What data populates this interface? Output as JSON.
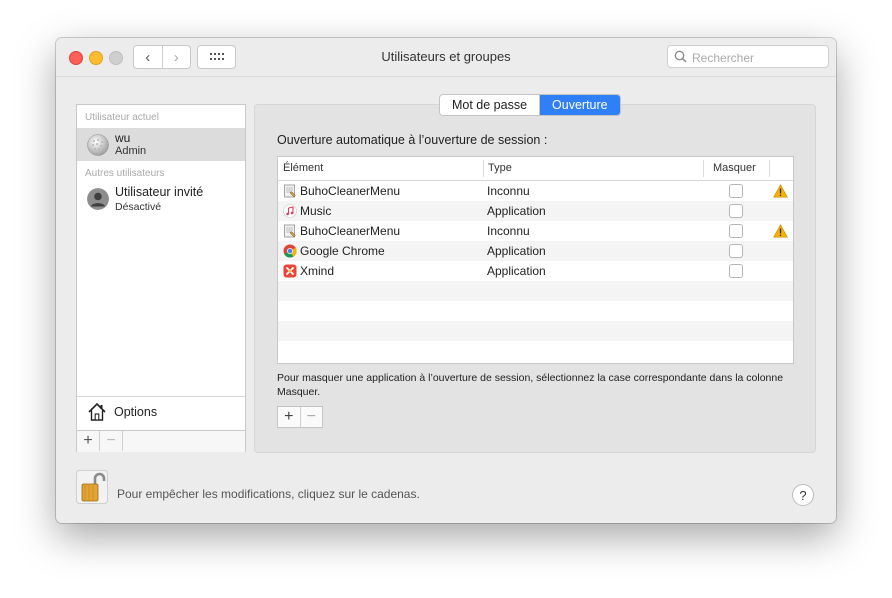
{
  "window": {
    "title": "Utilisateurs et groupes"
  },
  "toolbar": {
    "back_label": "‹",
    "forward_label": "›",
    "search_placeholder": "Rechercher"
  },
  "sidebar": {
    "current_section": "Utilisateur actuel",
    "current_user": {
      "name": "wu",
      "role": "Admin"
    },
    "other_section": "Autres utilisateurs",
    "other_users": [
      {
        "name": "Utilisateur invité",
        "status": "Désactivé"
      }
    ],
    "options_label": "Options",
    "add_label": "+",
    "remove_label": "−"
  },
  "tabs": [
    {
      "label": "Mot de passe",
      "active": false
    },
    {
      "label": "Ouverture",
      "active": true
    }
  ],
  "main": {
    "heading": "Ouverture automatique à l’ouverture de session :",
    "columns": {
      "element": "Élément",
      "type": "Type",
      "hide": "Masquer"
    },
    "rows": [
      {
        "name": "BuhoCleanerMenu",
        "type": "Inconnu",
        "icon": "generic-app-icon",
        "hide": false,
        "warning": true
      },
      {
        "name": "Music",
        "type": "Application",
        "icon": "music-icon",
        "hide": false,
        "warning": false
      },
      {
        "name": "BuhoCleanerMenu",
        "type": "Inconnu",
        "icon": "generic-app-icon",
        "hide": false,
        "warning": true
      },
      {
        "name": "Google Chrome",
        "type": "Application",
        "icon": "chrome-icon",
        "hide": false,
        "warning": false
      },
      {
        "name": "Xmind",
        "type": "Application",
        "icon": "xmind-icon",
        "hide": false,
        "warning": false
      }
    ],
    "note": "Pour masquer une application à l’ouverture de session, sélectionnez la case correspondante dans la colonne Masquer.",
    "add_label": "+",
    "remove_label": "−"
  },
  "footer": {
    "lock_text": "Pour empêcher les modifications, cliquez sur le cadenas.",
    "help_label": "?"
  },
  "colors": {
    "accent": "#2f7ff6",
    "warning": "#f5b400"
  }
}
